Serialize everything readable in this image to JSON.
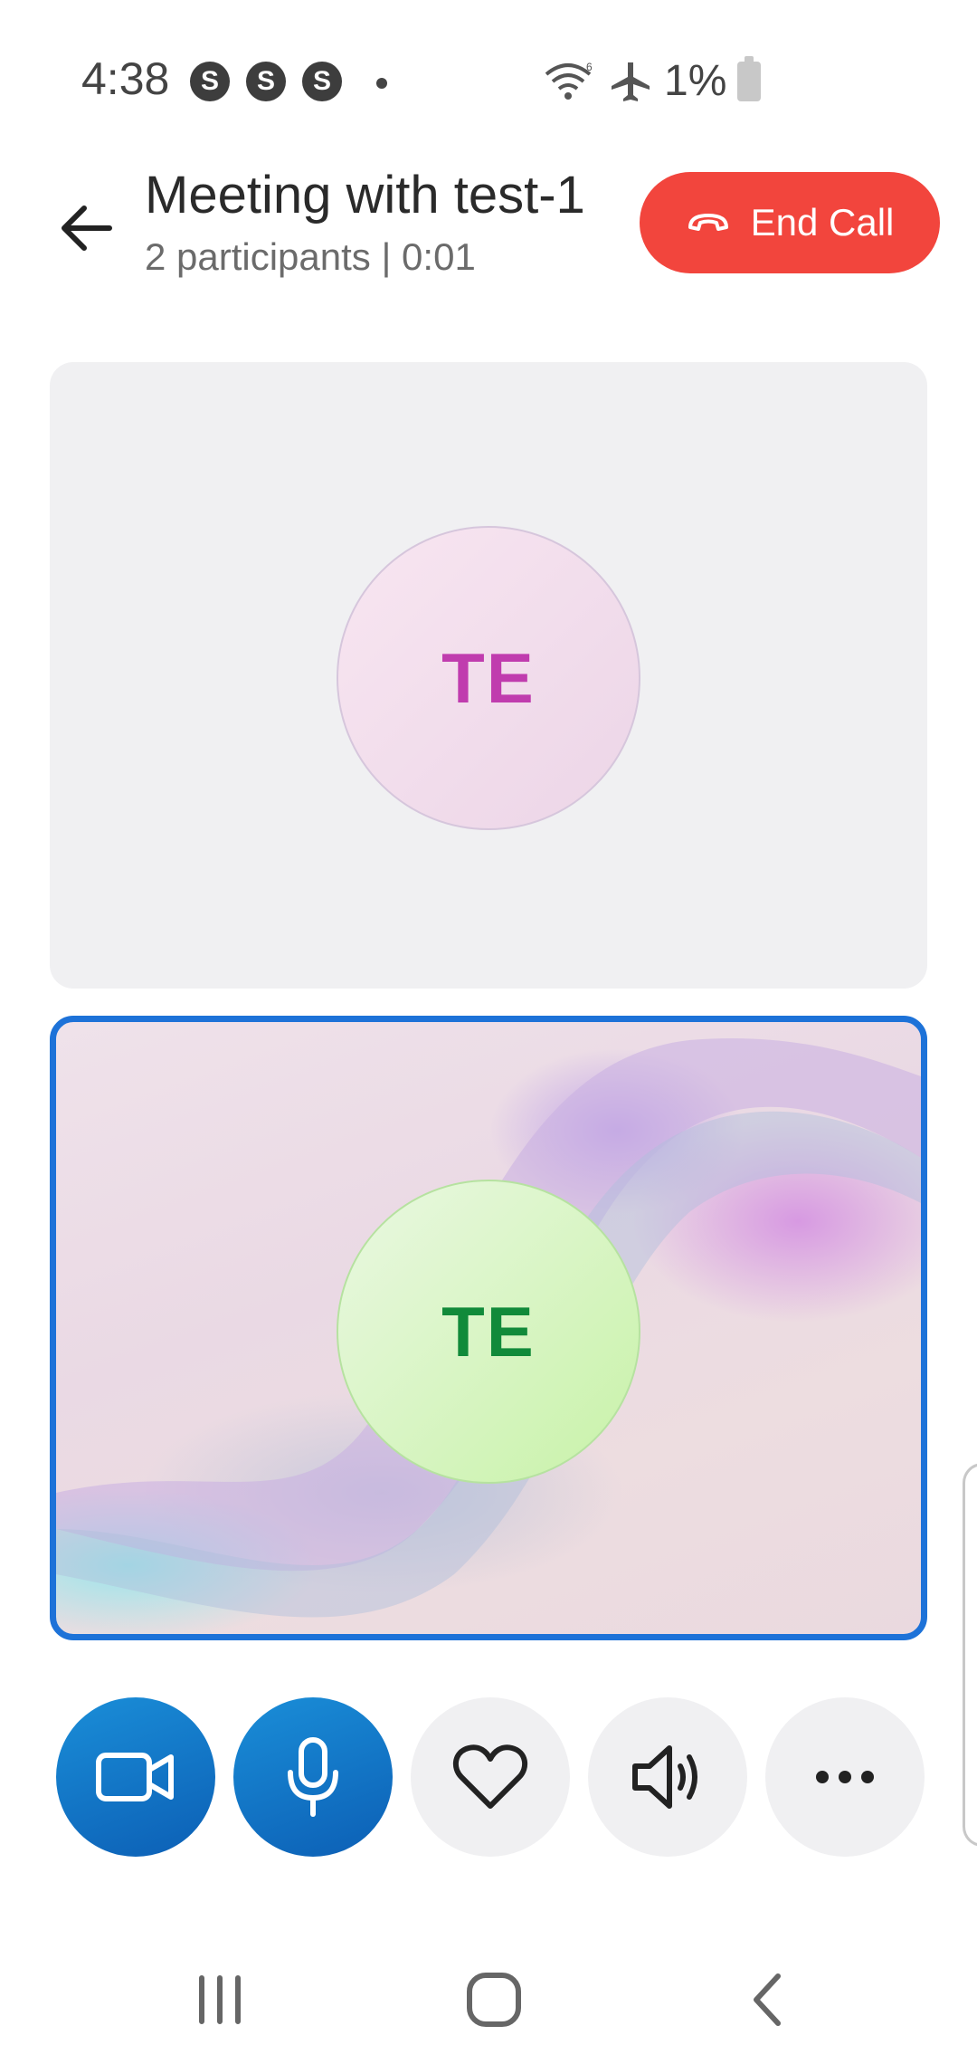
{
  "status_bar": {
    "time": "4:38",
    "skype_badges": [
      "S",
      "S",
      "S"
    ],
    "battery_percent": "1%",
    "icons": [
      "wifi-icon",
      "airplane-icon",
      "battery-icon"
    ]
  },
  "header": {
    "title": "Meeting with test-1",
    "subtitle": "2 participants | 0:01",
    "end_call_label": "End Call"
  },
  "participants": [
    {
      "initials": "TE",
      "color": "#c03cae"
    },
    {
      "initials": "TE",
      "color": "#118a3a"
    }
  ],
  "controls": [
    {
      "name": "video-button",
      "icon": "video-camera-icon",
      "active": true
    },
    {
      "name": "mic-button",
      "icon": "microphone-icon",
      "active": true
    },
    {
      "name": "react-button",
      "icon": "heart-icon",
      "active": false
    },
    {
      "name": "speaker-button",
      "icon": "speaker-icon",
      "active": false
    },
    {
      "name": "more-options-button",
      "icon": "more-horizontal-icon",
      "active": false
    }
  ],
  "nav_bar": [
    "recent-apps-icon",
    "home-icon",
    "back-icon"
  ],
  "colors": {
    "accent_blue": "#1d72d8",
    "end_call_red": "#f2453d",
    "tile_background": "#f0f0f2"
  }
}
